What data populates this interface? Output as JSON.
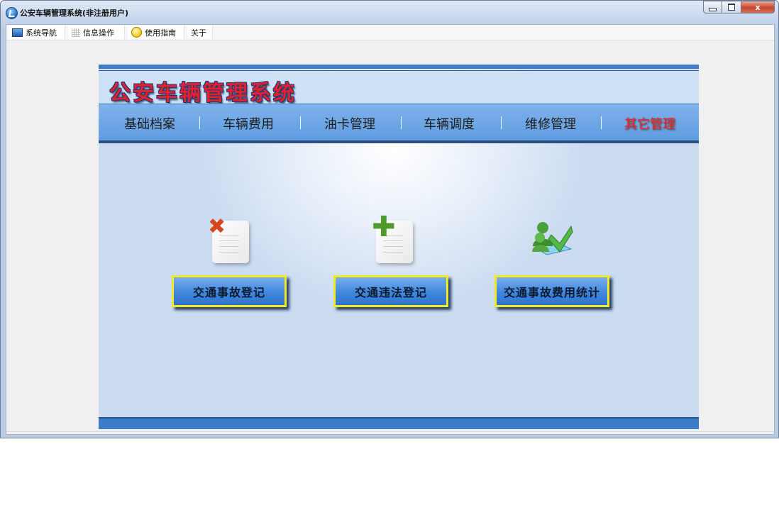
{
  "window": {
    "title": "公安车辆管理系统(非注册用户)",
    "close_glyph": "x"
  },
  "menu": {
    "items": [
      {
        "label": "系统导航",
        "icon": "monitor-icon"
      },
      {
        "label": "信息操作",
        "icon": "grid-icon"
      },
      {
        "label": "使用指南",
        "icon": "help-icon"
      },
      {
        "label": "关于",
        "icon": ""
      }
    ]
  },
  "panel": {
    "system_title": "公安车辆管理系统",
    "nav": [
      {
        "label": "基础档案"
      },
      {
        "label": "车辆费用"
      },
      {
        "label": "油卡管理"
      },
      {
        "label": "车辆调度"
      },
      {
        "label": "维修管理"
      },
      {
        "label": "其它管理",
        "active": true
      }
    ],
    "nav_separator": "|",
    "modules": [
      {
        "label": "交通事故登记",
        "icon": "document-delete-icon"
      },
      {
        "label": "交通违法登记",
        "icon": "document-add-icon"
      },
      {
        "label": "交通事故费用统计",
        "icon": "users-download-icon"
      }
    ]
  },
  "colors": {
    "accent_blue": "#3b7bc8",
    "title_red": "#e2212e",
    "active_nav": "#ff1f1f",
    "button_border": "#f2ea24"
  }
}
